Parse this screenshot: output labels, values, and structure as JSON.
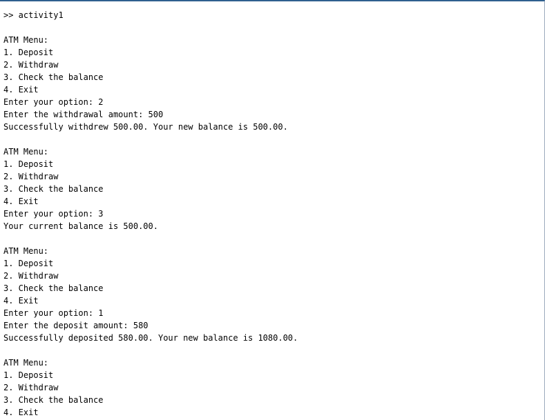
{
  "console": {
    "lines": [
      ">> activity1",
      "",
      "ATM Menu:",
      "1. Deposit",
      "2. Withdraw",
      "3. Check the balance",
      "4. Exit",
      "Enter your option: 2",
      "Enter the withdrawal amount: 500",
      "Successfully withdrew 500.00. Your new balance is 500.00.",
      "",
      "ATM Menu:",
      "1. Deposit",
      "2. Withdraw",
      "3. Check the balance",
      "4. Exit",
      "Enter your option: 3",
      "Your current balance is 500.00.",
      "",
      "ATM Menu:",
      "1. Deposit",
      "2. Withdraw",
      "3. Check the balance",
      "4. Exit",
      "Enter your option: 1",
      "Enter the deposit amount: 580",
      "Successfully deposited 580.00. Your new balance is 1080.00.",
      "",
      "ATM Menu:",
      "1. Deposit",
      "2. Withdraw",
      "3. Check the balance",
      "4. Exit"
    ]
  }
}
